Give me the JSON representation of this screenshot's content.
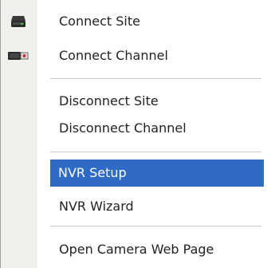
{
  "menu": {
    "items": [
      {
        "label": "Connect Site",
        "icon": "server-icon"
      },
      {
        "label": "Connect Channel",
        "icon": "camera-icon"
      },
      {
        "label": "Disconnect Site"
      },
      {
        "label": "Disconnect Channel"
      },
      {
        "label": "NVR Setup",
        "selected": true
      },
      {
        "label": "NVR Wizard"
      },
      {
        "label": "Open Camera Web Page"
      }
    ]
  },
  "colors": {
    "selection": "#2f6bc6",
    "gutter": "#f0f0ec",
    "separator": "#c8c8c4",
    "text": "#222222"
  }
}
